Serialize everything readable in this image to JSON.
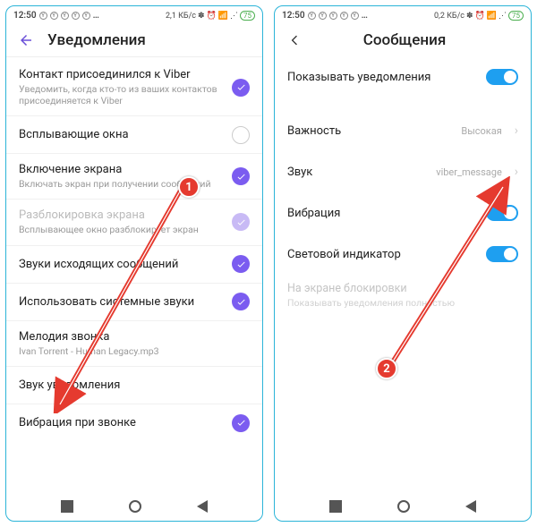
{
  "left": {
    "status": {
      "time": "12:50",
      "net": "2,1 КБ/с",
      "battery": "75"
    },
    "header": {
      "title": "Уведомления"
    },
    "rows": [
      {
        "title": "Контакт присоединился к Viber",
        "sub": "Уведомить, когда кто-то из ваших контактов присоединяется к Viber",
        "check": "on"
      },
      {
        "title": "Всплывающие окна",
        "check": "empty"
      },
      {
        "title": "Включение экрана",
        "sub": "Включать экран при получении сообщений",
        "check": "on"
      },
      {
        "title": "Разблокировка экрана",
        "sub": "Всплывающее окно разблокирует экран",
        "dim": true,
        "check": "dim"
      },
      {
        "title": "Звуки исходящих сообщений",
        "check": "on"
      },
      {
        "title": "Использовать системные звуки",
        "check": "on"
      },
      {
        "title": "Мелодия звонка",
        "sub": "Ivan Torrent - Human Legacy.mp3"
      },
      {
        "title": "Звук уведомления"
      },
      {
        "title": "Вибрация при звонке",
        "check": "on"
      }
    ]
  },
  "right": {
    "status": {
      "time": "12:50",
      "net": "0,2 КБ/с",
      "battery": "75"
    },
    "header": {
      "title": "Сообщения"
    },
    "rows": [
      {
        "title": "Показывать уведомления",
        "toggle": true
      },
      {
        "gap": true
      },
      {
        "title": "Важность",
        "value": "Высокая",
        "chev": true
      },
      {
        "title": "Звук",
        "value": "viber_message",
        "chev": true
      },
      {
        "title": "Вибрация",
        "toggle": true
      },
      {
        "title": "Световой индикатор",
        "toggle": true
      }
    ],
    "disabled": {
      "title": "На экране блокировки",
      "sub": "Показывать уведомления полностью"
    }
  },
  "badges": {
    "one": "1",
    "two": "2"
  }
}
